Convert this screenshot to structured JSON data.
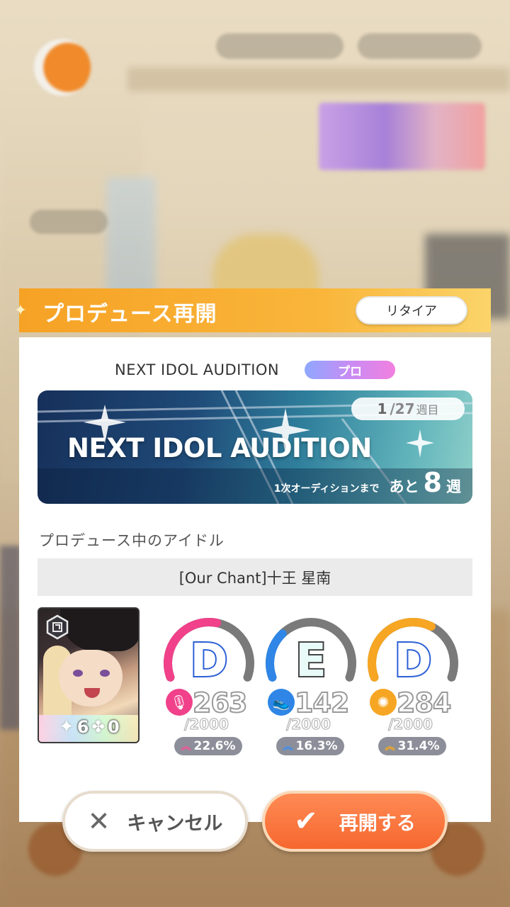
{
  "dialog": {
    "title": "プロデュース再開",
    "retire_label": "リタイア"
  },
  "audition": {
    "name": "NEXT IDOL AUDITION",
    "difficulty_badge": "プロ",
    "banner_title": "NEXT IDOL AUDITION",
    "week_current": "1",
    "week_total": "/27",
    "week_unit": "週目",
    "until_label": "1次オーディションまで",
    "remaining_prefix": "あと",
    "remaining_weeks": "8",
    "remaining_unit": "週"
  },
  "idol": {
    "section_label": "プロデュース中のアイドル",
    "name": "[Our Chant]十王 星南",
    "card_stars": "6",
    "card_clovers": "0"
  },
  "params": [
    {
      "key": "vocal",
      "grade": "D",
      "value": "263",
      "max": "/2000",
      "growth": "22.6%",
      "gauge_fraction": 0.55,
      "color": "#f0418a",
      "icon": "microphone-icon"
    },
    {
      "key": "dance",
      "grade": "E",
      "value": "142",
      "max": "/2000",
      "growth": "16.3%",
      "gauge_fraction": 0.3,
      "color": "#2f86e6",
      "icon": "shoe-icon"
    },
    {
      "key": "visual",
      "grade": "D",
      "value": "284",
      "max": "/2000",
      "growth": "31.4%",
      "gauge_fraction": 0.62,
      "color": "#f6a623",
      "icon": "visual-icon"
    }
  ],
  "buttons": {
    "cancel": "キャンセル",
    "resume": "再開する"
  }
}
